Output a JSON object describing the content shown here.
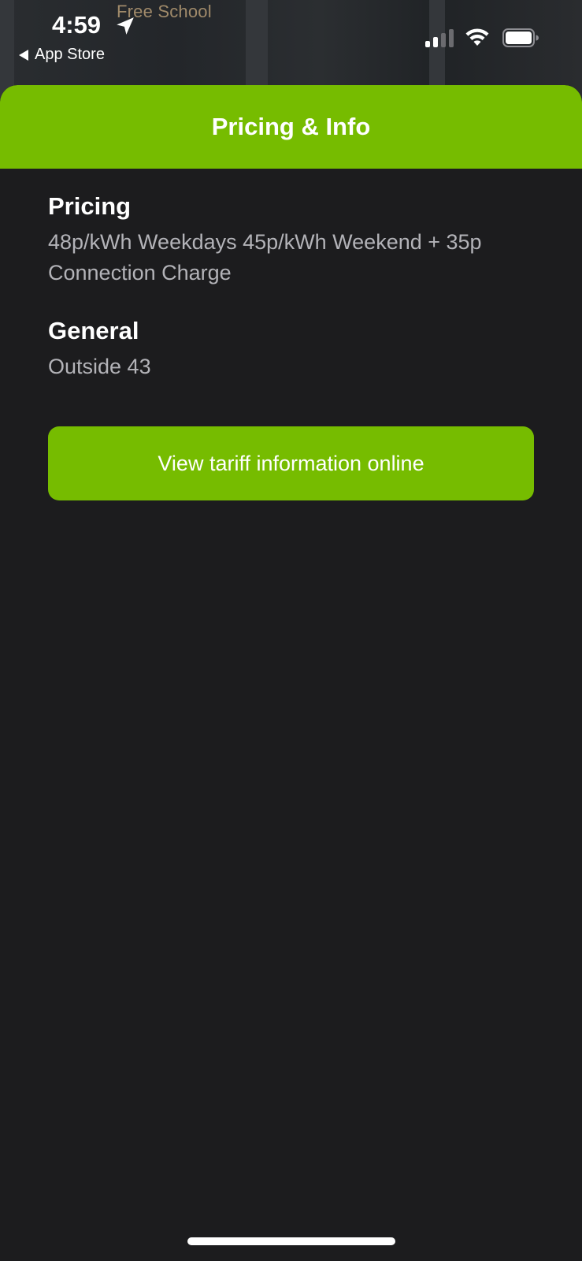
{
  "status_bar": {
    "time": "4:59",
    "back_label": "App Store",
    "map_label": "Free School",
    "signal_bars_active": 2,
    "signal_bars_total": 4
  },
  "sheet": {
    "title": "Pricing & Info",
    "sections": [
      {
        "heading": "Pricing",
        "text": "48p/kWh Weekdays 45p/kWh Weekend + 35p Connection Charge"
      },
      {
        "heading": "General",
        "text": "Outside 43"
      }
    ],
    "button_label": "View tariff information online"
  },
  "colors": {
    "accent": "#76bc00",
    "background": "#1c1c1e",
    "secondary_text": "#b3b3b8"
  },
  "icons": [
    "location-arrow-icon",
    "back-arrow-icon",
    "cellular-signal-icon",
    "wifi-icon",
    "battery-icon"
  ]
}
